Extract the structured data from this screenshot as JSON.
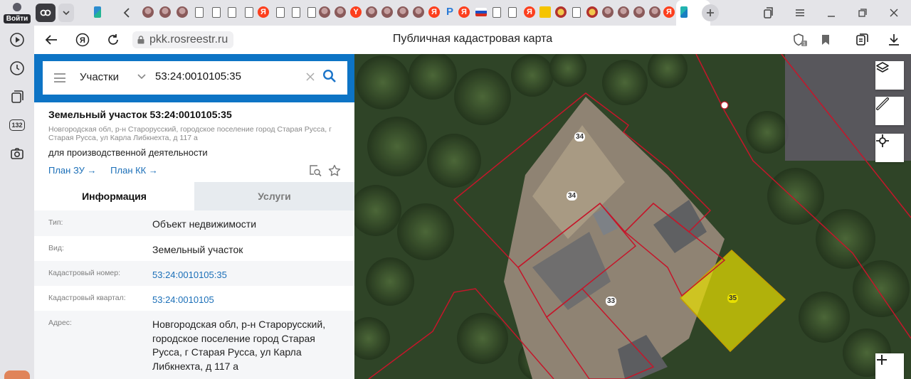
{
  "browser": {
    "login_label": "Войти",
    "badge_count": "132",
    "url": "pkk.rosreestr.ru",
    "page_title": "Публичная кадастровая карта",
    "bookmarks_count": "1"
  },
  "search": {
    "type_label": "Участки",
    "value": "53:24:0010105:35"
  },
  "card": {
    "title": "Земельный участок 53:24:0010105:35",
    "address_small": "Новгородская обл, р-н Старорусский, городское поселение город Старая Русса, г Старая Русса, ул Карла Либкнехта, д 117 а",
    "usage": "для производственной деятельности",
    "link_plan_zu": "План ЗУ →",
    "link_plan_kk": "План КК →"
  },
  "tabs": {
    "info": "Информация",
    "services": "Услуги"
  },
  "rows": [
    {
      "key": "Тип:",
      "value": "Объект недвижимости"
    },
    {
      "key": "Вид:",
      "value": "Земельный участок"
    },
    {
      "key": "Кадастровый номер:",
      "value": "53:24:0010105:35"
    },
    {
      "key": "Кадастровый квартал:",
      "value": "53:24:0010105"
    },
    {
      "key": "Адрес:",
      "value": "Новгородская обл, р-н Старорусский, городское поселение город Старая Русса, г Старая Русса, ул Карла Либкнехта, д 117 а"
    }
  ],
  "map": {
    "labels": [
      "34",
      "34",
      "33",
      "35"
    ],
    "plot_outline_color": "#c5162a",
    "selected_fill_color": "#e8e000"
  }
}
